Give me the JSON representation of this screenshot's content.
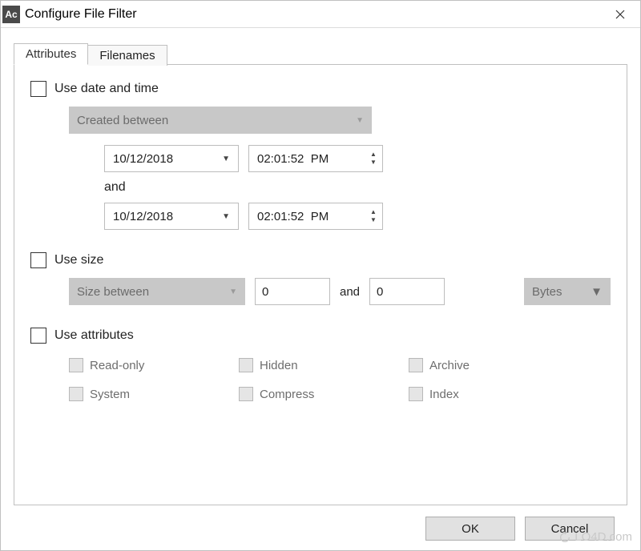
{
  "window": {
    "app_icon_text": "Ac",
    "title": "Configure File Filter"
  },
  "tabs": {
    "attributes": "Attributes",
    "filenames": "Filenames"
  },
  "date_section": {
    "label": "Use date and time",
    "mode": "Created between",
    "date1": "10/12/2018",
    "time1": "02:01:52  PM",
    "and": "and",
    "date2": "10/12/2018",
    "time2": "02:01:52  PM"
  },
  "size_section": {
    "label": "Use size",
    "mode": "Size between",
    "value1": "0",
    "and": "and",
    "value2": "0",
    "unit": "Bytes"
  },
  "attr_section": {
    "label": "Use attributes",
    "readonly": "Read-only",
    "hidden": "Hidden",
    "archive": "Archive",
    "system": "System",
    "compress": "Compress",
    "index": "Index"
  },
  "buttons": {
    "ok": "OK",
    "cancel": "Cancel"
  },
  "watermark": "LO4D.com"
}
